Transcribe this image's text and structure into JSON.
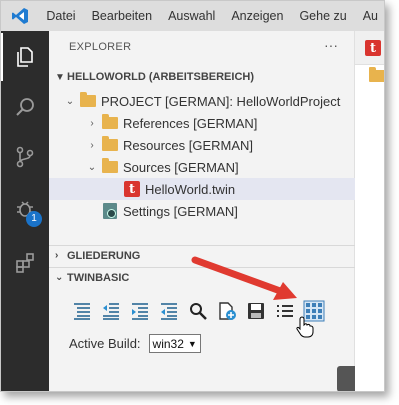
{
  "menubar": {
    "items": [
      "Datei",
      "Bearbeiten",
      "Auswahl",
      "Anzeigen",
      "Gehe zu",
      "Au"
    ]
  },
  "activity": {
    "debug_badge": "1"
  },
  "explorer": {
    "title": "EXPLORER",
    "more": "···",
    "workspace": "HELLOWORLD (ARBEITSBEREICH)",
    "tree": [
      {
        "label": "PROJECT [GERMAN]: HelloWorldProject"
      },
      {
        "label": "References [GERMAN]"
      },
      {
        "label": "Resources [GERMAN]"
      },
      {
        "label": "Sources [GERMAN]"
      },
      {
        "label": "HelloWorld.twin"
      },
      {
        "label": "Settings [GERMAN]"
      }
    ]
  },
  "sections": {
    "outline": "GLIEDERUNG",
    "twinbasic": "TWINBASIC"
  },
  "twinbasic": {
    "active_build_label": "Active Build:",
    "active_build_value": "win32",
    "tooltip": "Build"
  },
  "colors": {
    "accent_blue": "#1a73c9",
    "folder": "#e8b34d",
    "twin_red": "#d9352f",
    "arrow_red": "#e03a30"
  },
  "icons": {
    "logo": "vscode-logo-icon",
    "explorer": "files-icon",
    "search": "search-icon",
    "scm": "source-control-icon",
    "debug": "run-debug-icon",
    "extensions": "extensions-icon"
  }
}
